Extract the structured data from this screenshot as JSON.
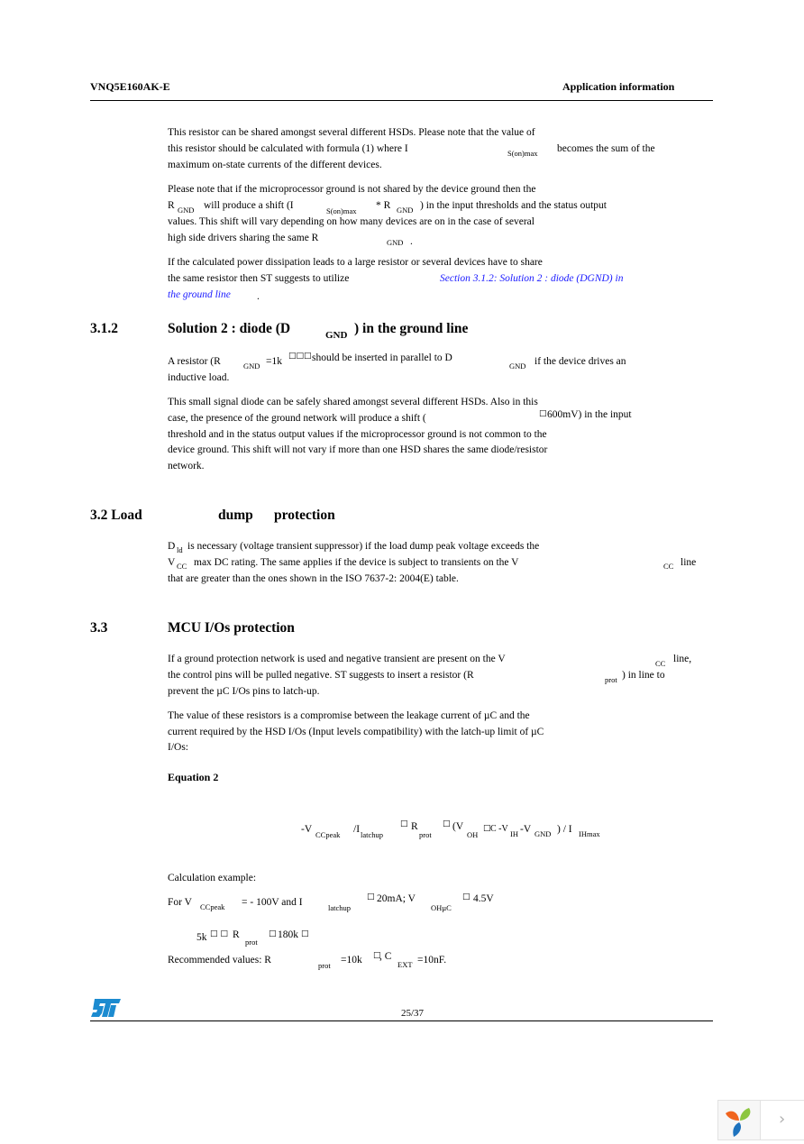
{
  "header": {
    "doc_id": "VNQ5E160AK-E",
    "section_title": "Application information"
  },
  "p1": {
    "l1": "This resistor can be shared amongst several different HSDs. Please note that the value of",
    "l2a": "this resistor should be calculated with formula (1) where I",
    "l2sub": "S(on)max",
    "l2b": "becomes the sum of the",
    "l3": "maximum on-state currents of the different devices."
  },
  "p2": {
    "l1": "Please note that if the microprocessor ground is not shared by the device ground then the",
    "l2a": "R",
    "l2sub1": "GND",
    "l2b": "will produce a shift (I",
    "l2sub2": "S(on)max",
    "l2c": "* R",
    "l2sub3": "GND",
    "l2d": ") in the input thresholds and the status output",
    "l3": "values. This shift will vary depending on how many devices are on in the case of several",
    "l4a": "high side drivers sharing the same R",
    "l4sub": "GND",
    "l4b": "."
  },
  "p3": {
    "l1": "If the calculated power dissipation leads to a large resistor or several devices have to share",
    "l2a": "the same resistor then  ST suggests to utilize",
    "link1": "Section 3.1.2: Solution 2 : diode (DGND) in",
    "link2": "the ground line",
    "l3b": "."
  },
  "s312": {
    "number": "3.1.2",
    "title_a": "Solution 2 : diode (D",
    "title_sub": "GND",
    "title_b": ") in the ground line",
    "p1": {
      "l1a": "A resistor (R",
      "l1sub1": "GND",
      "l1b": "=1k",
      "l1box": "□□□",
      "l1c": "should be inserted in parallel to D",
      "l1sub2": "GND",
      "l1d": "if the device drives an",
      "l2": "inductive load."
    },
    "p2": {
      "l1": "This small signal diode can be safely shared amongst several different HSDs. Also in this",
      "l2a": "case, the presence of the ground network will produce a shift (",
      "l2box": "□",
      "l2b": "600mV) in the input",
      "l3": "threshold and in the status output values if the microprocessor ground is not common to the",
      "l4": "device ground. This shift will not vary if more than one HSD shares the same diode/resistor",
      "l5": "network."
    }
  },
  "s32": {
    "number_title": "3.2 Load",
    "title_b": "dump",
    "title_c": "protection",
    "p1": {
      "l1a": "D",
      "l1sub": "ld",
      "l1b": "is necessary (voltage transient suppressor) if the load dump peak voltage exceeds the",
      "l2a": "V",
      "l2sub1": "CC",
      "l2b": "max DC rating. The same applies if the device is subject to transients on the V",
      "l2sub2": "CC",
      "l2c": "line",
      "l3": "that are greater than the ones shown in the ISO 7637-2: 2004(E) table."
    }
  },
  "s33": {
    "number": "3.3",
    "title": "MCU I/Os protection",
    "p1": {
      "l1a": "If a ground protection network is used and negative transient are present on the V",
      "l1sub": "CC",
      "l1b": "line,",
      "l2a": "the control pins will be pulled negative. ST suggests to insert a resistor (R",
      "l2sub": "prot",
      "l2b": ") in line to",
      "l3": "prevent the µC I/Os pins to latch-up."
    },
    "p2": {
      "l1": "The value of these resistors is a compromise between the leakage current of µC and the",
      "l2": "current required by the HSD I/Os (Input levels compatibility) with the latch-up limit of µC",
      "l3": "I/Os:"
    },
    "equation_label": "Equation 2",
    "equation": {
      "t1": "-V",
      "s1": "CCpeak",
      "t2": "/I",
      "s2": "latchup",
      "box1": "□",
      "t3": "R",
      "s3": "prot",
      "box2": "□",
      "t4": "(V",
      "s4": "OH",
      "box3": "□",
      "t5": "C -V",
      "s5": "IH",
      "t6": "-V",
      "s6": "GND",
      "t7": ") / I",
      "s7": "IHmax"
    },
    "calc_label": "Calculation example:",
    "calc1": {
      "t1": "For V",
      "s1": "CCpeak",
      "t2": "= - 100V and I",
      "s2": "latchup",
      "box1": "□",
      "t3": "20mA; V",
      "s3": "OHµC",
      "box2": "□",
      "t4": "4.5V"
    },
    "calc2": {
      "t1": "5k",
      "box1": "□ □",
      "t2": "R",
      "s2": "prot",
      "box2": "□",
      "t3": "180k",
      "box3": "□"
    },
    "recommended": {
      "t1": "Recommended values: R",
      "s1": "prot",
      "t2": "=10k",
      "box1": "□",
      "t3": ", C",
      "s3": "EXT",
      "t4": "=10nF."
    }
  },
  "footer": {
    "logo": "ST",
    "page": "25/37",
    "logo_color": "#1c8bd0"
  },
  "viewer": {
    "next_label": "›"
  }
}
